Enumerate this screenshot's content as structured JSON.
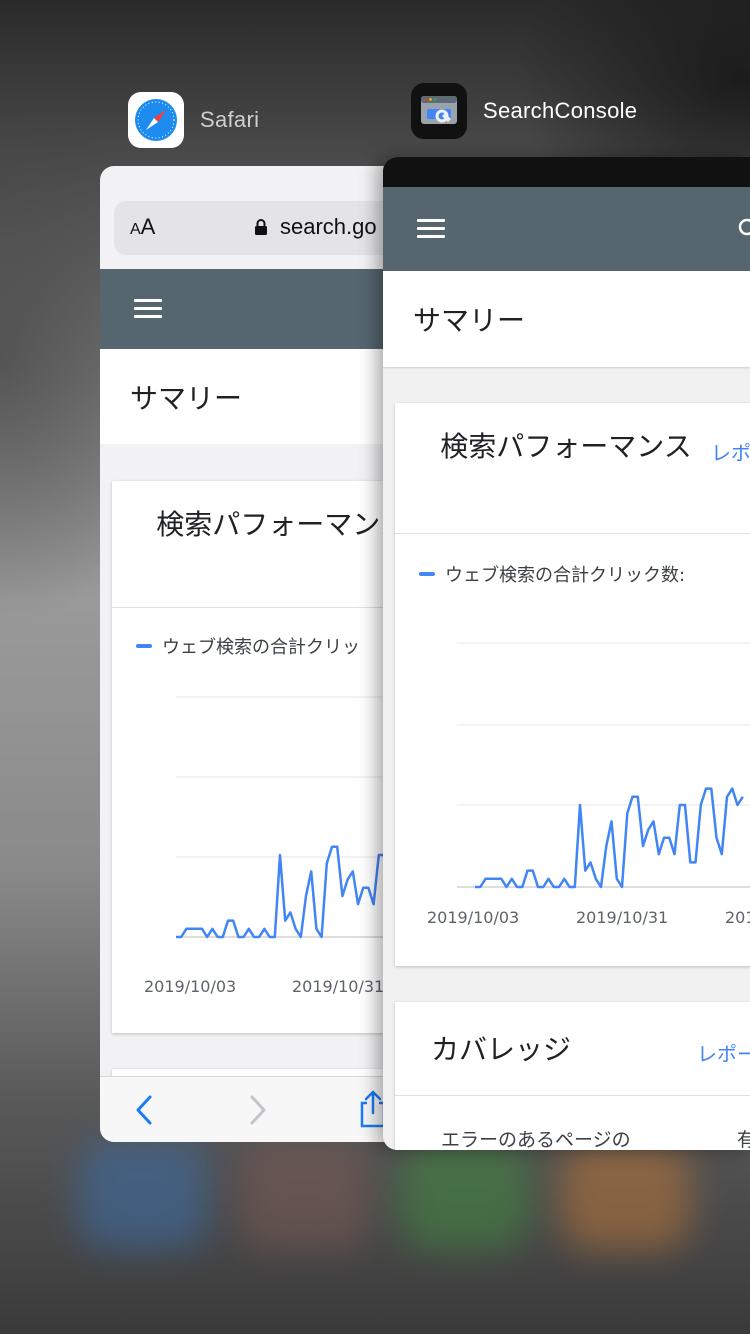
{
  "switcher": {
    "apps": [
      {
        "name": "Safari"
      },
      {
        "name": "SearchConsole"
      }
    ]
  },
  "safari": {
    "url_text_size_label": "AA",
    "url": "search.go",
    "page_title": "サマリー",
    "performance": {
      "title": "検索パフォーマンス",
      "legend": "ウェブ検索の合計クリッ",
      "x_ticks": [
        "2019/10/03",
        "2019/10/31"
      ]
    }
  },
  "searchconsole": {
    "page_title": "サマリー",
    "performance": {
      "title": "検索パフォーマンス",
      "link": "レポ",
      "legend": "ウェブ検索の合計クリック数:",
      "x_ticks": [
        "2019/10/03",
        "2019/10/31",
        "201"
      ]
    },
    "coverage": {
      "title": "カバレッジ",
      "link": "レポー",
      "col1": "エラーのあるページの",
      "col2": "有"
    }
  },
  "colors": {
    "toolbar": "#56666f",
    "series": "#4285f4",
    "link": "#4285f4"
  },
  "chart_data": {
    "type": "line",
    "x": [
      "2019/10/03",
      "2019/10/31"
    ],
    "series": [
      {
        "values": [
          0,
          0,
          1,
          1,
          1,
          1,
          0,
          1,
          0,
          0,
          2,
          2,
          0,
          0,
          1,
          0,
          0,
          1,
          0,
          0,
          10,
          2,
          3,
          1,
          0,
          5,
          8,
          1,
          0,
          9,
          11,
          11,
          5,
          7,
          8,
          4,
          6,
          6,
          4,
          10,
          10,
          3,
          3,
          10,
          12,
          12,
          6,
          4,
          11,
          12,
          10,
          11
        ]
      }
    ],
    "grid": true,
    "legend": "top-left"
  }
}
